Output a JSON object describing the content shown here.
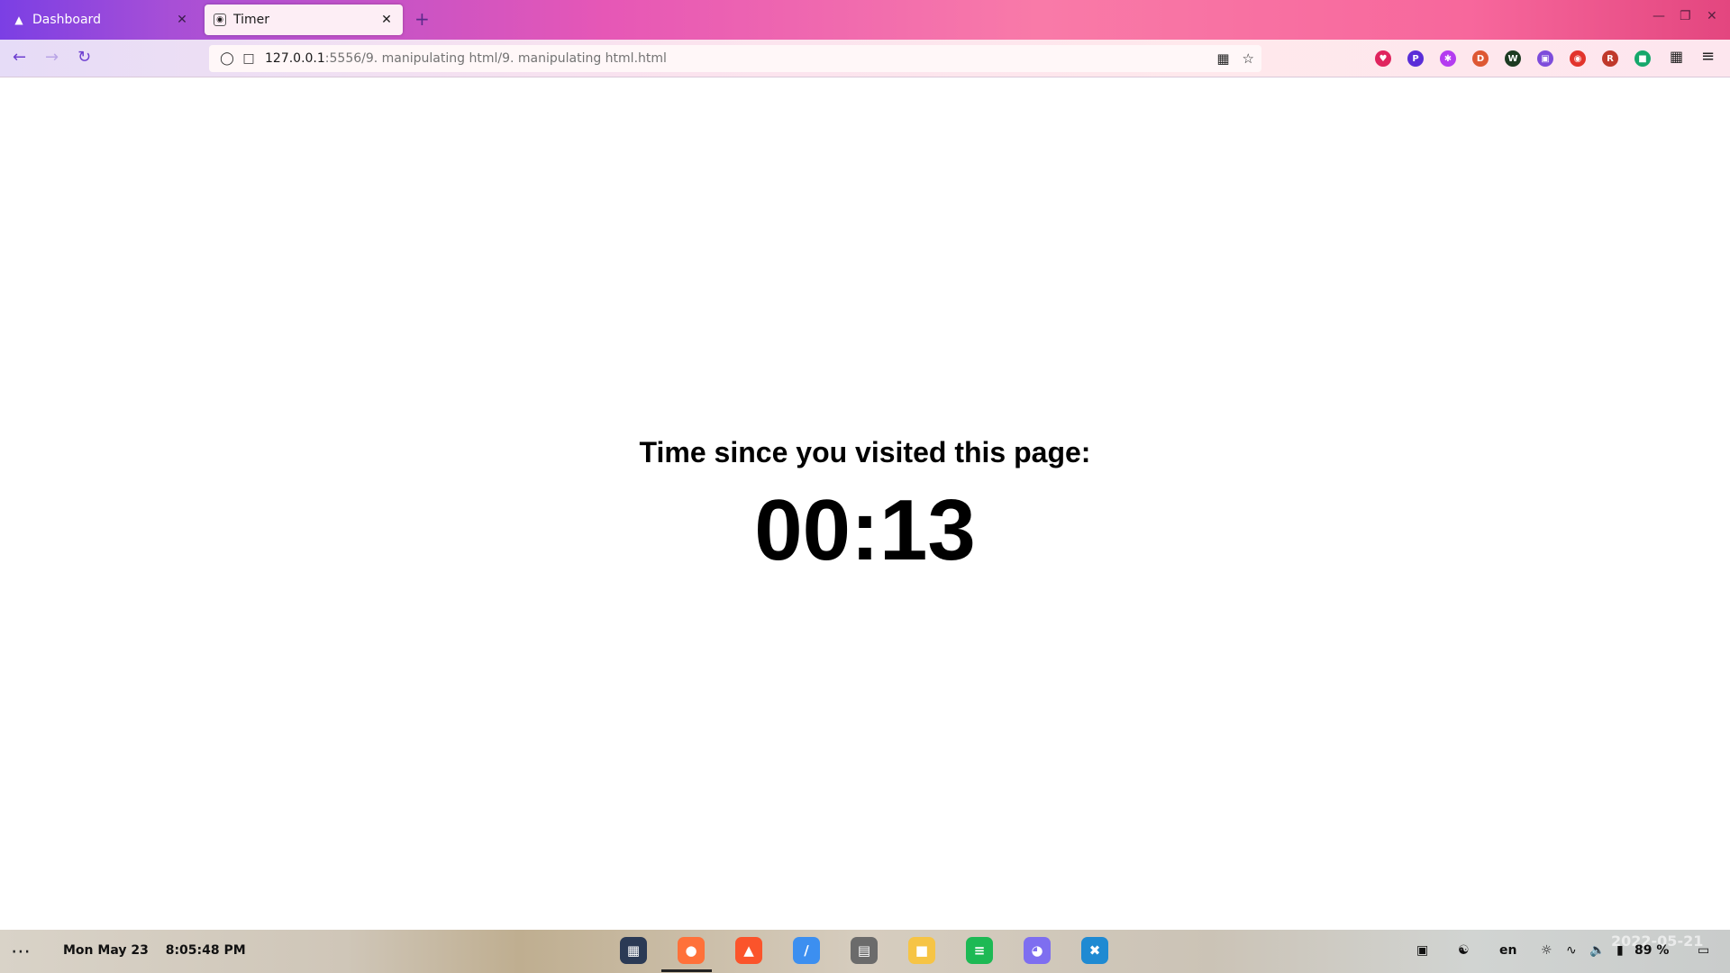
{
  "browser": {
    "tabs": [
      {
        "label": "Dashboard",
        "icon": "dashboard-favicon",
        "active": false
      },
      {
        "label": "Timer",
        "icon": "timer-favicon",
        "active": true
      }
    ],
    "new_tab_glyph": "+",
    "url": {
      "host": "127.0.0.1",
      "path": ":5556/9. manipulating html/9. manipulating html.html"
    },
    "extensions": [
      {
        "name": "pocket-icon",
        "color": "#e0245e",
        "glyph": "♥"
      },
      {
        "name": "extension-p-icon",
        "color": "#5a2dd8",
        "glyph": "P"
      },
      {
        "name": "extension-asterisk-icon",
        "color": "#b43cf0",
        "glyph": "✱"
      },
      {
        "name": "duckduckgo-icon",
        "color": "#de5833",
        "glyph": "D"
      },
      {
        "name": "shield-extension-icon",
        "color": "#1d3b22",
        "glyph": "W"
      },
      {
        "name": "cube-extension-icon",
        "color": "#7d4cdb",
        "glyph": "▣"
      },
      {
        "name": "screenshot-extension-icon",
        "color": "#e2342c",
        "glyph": "◉"
      },
      {
        "name": "reader-extension-icon",
        "color": "#c0392b",
        "glyph": "R"
      },
      {
        "name": "green-extension-icon",
        "color": "#15a86b",
        "glyph": "■"
      }
    ]
  },
  "page": {
    "heading": "Time since you visited this page:",
    "timer": "00:13"
  },
  "taskbar": {
    "date": "Mon May 23",
    "time": "8:05:48 PM",
    "dock": [
      {
        "name": "app-grid-dock-icon",
        "color": "#2b3a55",
        "glyph": "▦"
      },
      {
        "name": "firefox-icon",
        "color": "#ff7139",
        "glyph": "●"
      },
      {
        "name": "brave-icon",
        "color": "#fb542b",
        "glyph": "▲"
      },
      {
        "name": "web-browser-icon",
        "color": "#3c8ff0",
        "glyph": "∕"
      },
      {
        "name": "text-editor-icon",
        "color": "#6b6b6b",
        "glyph": "▤"
      },
      {
        "name": "files-icon",
        "color": "#f6c445",
        "glyph": "■"
      },
      {
        "name": "spotify-icon",
        "color": "#1db954",
        "glyph": "≡"
      },
      {
        "name": "discord-icon",
        "color": "#7e6ef0",
        "glyph": "◕"
      },
      {
        "name": "vscode-icon",
        "color": "#1f8ad2",
        "glyph": "✖"
      }
    ],
    "keyboard_layout": "en",
    "battery": "89 %",
    "watermark": "2022-05-21"
  }
}
